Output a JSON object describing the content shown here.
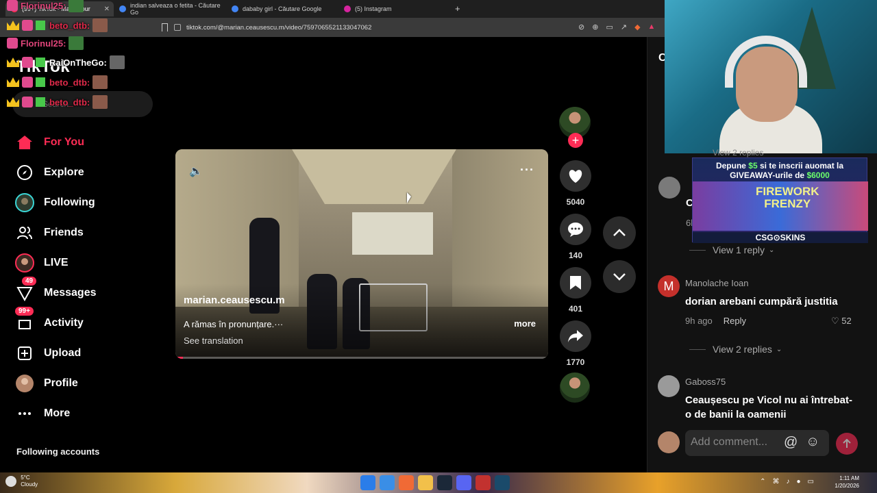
{
  "browser": {
    "tabs": [
      {
        "label": "(99+) TikTok - Make Your",
        "active": true,
        "color": "#fe2c55"
      },
      {
        "label": "indian salveaza o fetita - Căutare Go",
        "active": false,
        "color": "#4285f4"
      },
      {
        "label": "dababy girl - Căutare Google",
        "active": false,
        "color": "#4285f4"
      },
      {
        "label": "(5) Instagram",
        "active": false,
        "color": "#d6249f"
      }
    ],
    "new_tab": "+",
    "url": "tiktok.com/@marian.ceausescu.m/video/7597065521133047062"
  },
  "tiktok": {
    "logo": "TikTok",
    "search_placeholder": "Search",
    "nav": [
      {
        "label": "For You",
        "icon": "home-icon",
        "active": true
      },
      {
        "label": "Explore",
        "icon": "compass-icon"
      },
      {
        "label": "Following",
        "icon": "following-avatar-icon"
      },
      {
        "label": "Friends",
        "icon": "friends-icon"
      },
      {
        "label": "LIVE",
        "icon": "live-icon"
      },
      {
        "label": "Messages",
        "icon": "messages-icon",
        "badge": "49"
      },
      {
        "label": "Activity",
        "icon": "activity-icon",
        "badge": "99+"
      },
      {
        "label": "Upload",
        "icon": "upload-icon"
      },
      {
        "label": "Profile",
        "icon": "profile-avatar-icon"
      },
      {
        "label": "More",
        "icon": "more-dots-icon"
      }
    ],
    "following_accounts": "Following accounts",
    "video": {
      "username": "marian.ceausescu.m",
      "description": "A rămas în pronunțare.···",
      "more": "more",
      "see_translation": "See translation",
      "progress": 0.02
    },
    "actions": {
      "likes": "5040",
      "comments": "140",
      "saves": "401",
      "shares": "1770"
    }
  },
  "comments": {
    "header_partial": "C",
    "items": [
      {
        "view_replies": "View 1 reply",
        "partial_text": "C",
        "partial_meta": "6h"
      },
      {
        "avatar_letter": "M",
        "author": "Manolache Ioan",
        "text": "dorian arebani cumpără justitia",
        "time": "9h ago",
        "reply": "Reply",
        "likes": "52",
        "view_replies": "View 2 replies"
      },
      {
        "author": "Gaboss75",
        "text": "Ceaușescu pe Vicol nu ai întrebat-o de banii la oamenii"
      }
    ],
    "composer_placeholder": "Add comment...",
    "at_symbol": "@"
  },
  "overlay": {
    "chat": [
      {
        "user": "Florinul25:"
      },
      {
        "user": "beto_dtb:"
      },
      {
        "user": "Florinul25:"
      },
      {
        "user": "RaiOnTheGo:"
      },
      {
        "user": "beto_dtb:"
      },
      {
        "user": "beto_dtb:"
      }
    ],
    "promo": {
      "line1_a": "Depune ",
      "line1_amount": "$5",
      "line1_b": " si te inscrii auomat la",
      "line2_a": "GIVEAWAY-urile de ",
      "line2_amount": "$6000",
      "game_line1": "FIREWORK",
      "game_line2": "FRENZY",
      "brand": "CSG⊙SKINS"
    },
    "partial_view_replies": "View 2 replies"
  },
  "taskbar": {
    "temp": "5°C",
    "weather": "Cloudy",
    "time": "1:11 AM",
    "date": "1/20/2026"
  },
  "colors": {
    "accent": "#fe2c55",
    "bg": "#000000",
    "panel": "#121212"
  }
}
